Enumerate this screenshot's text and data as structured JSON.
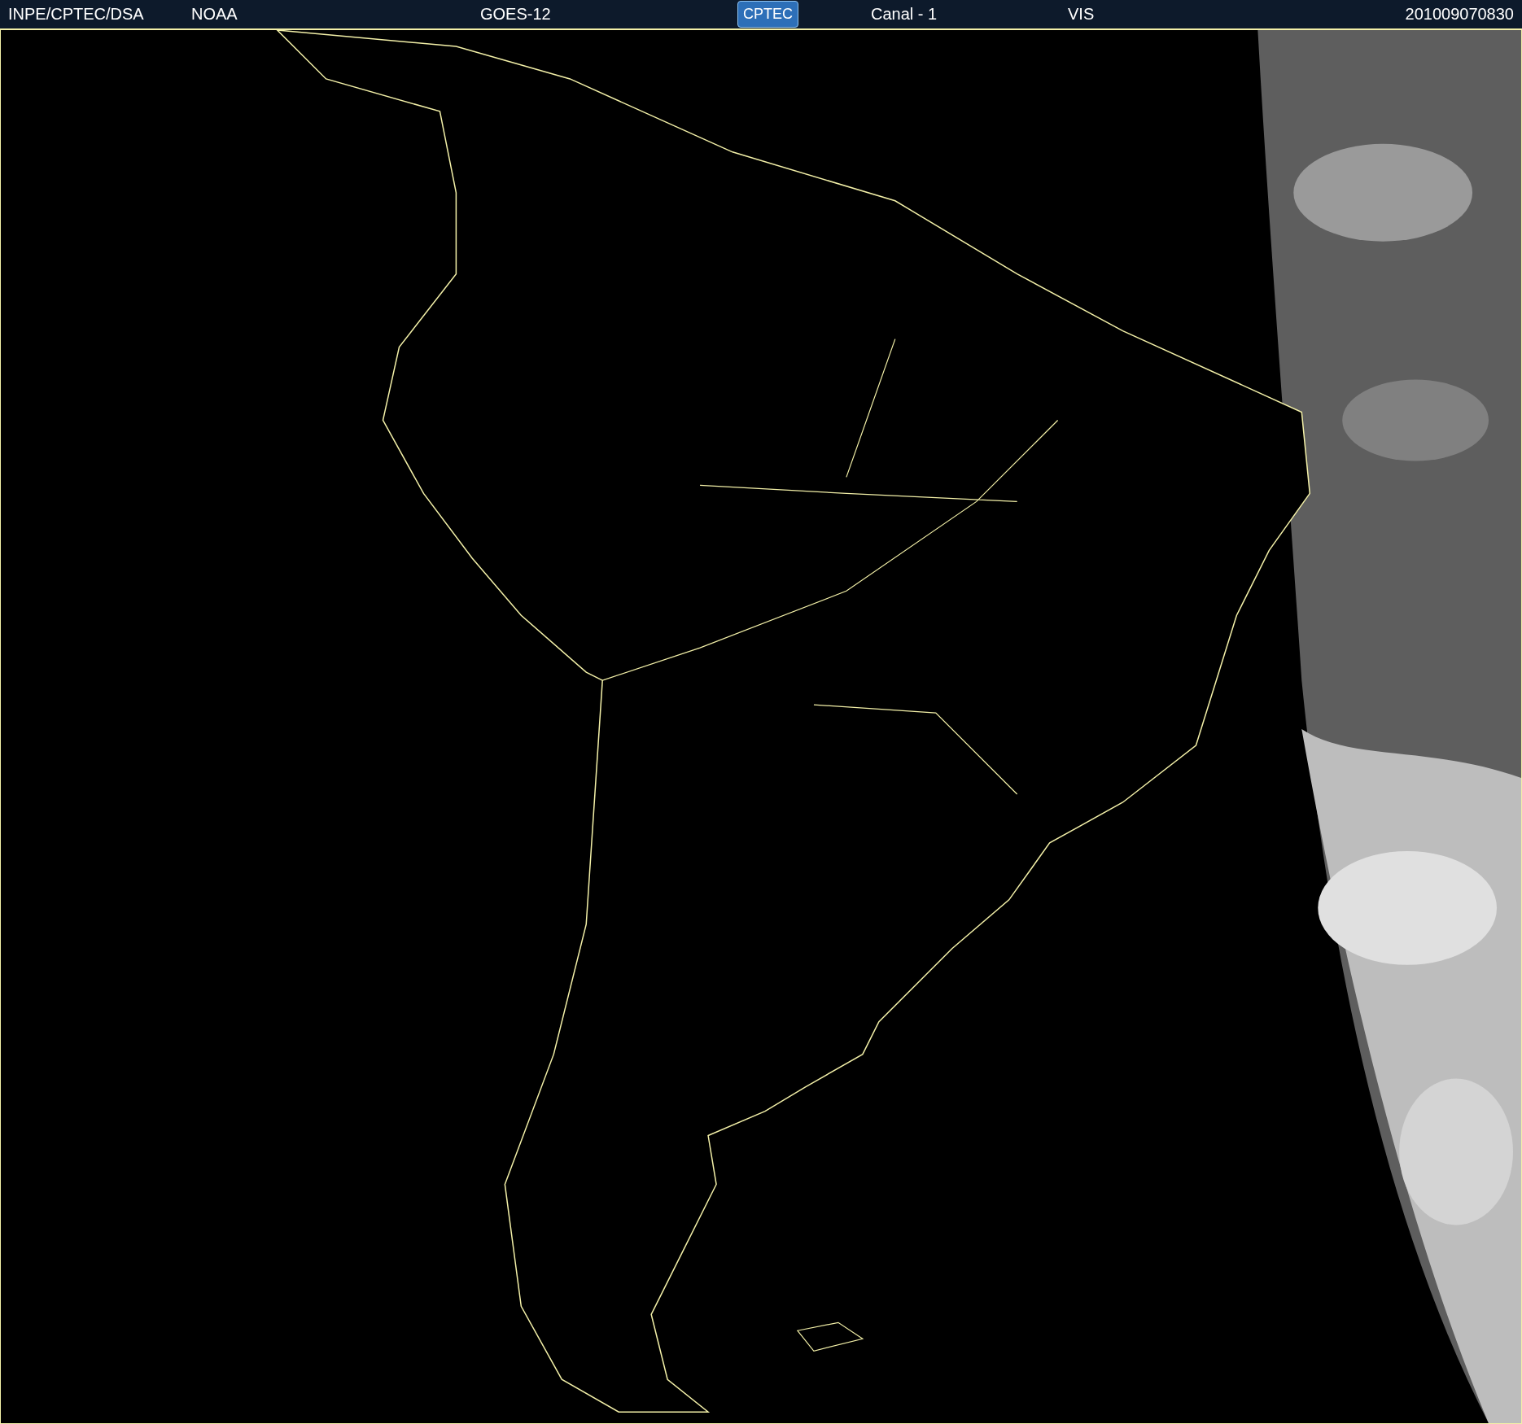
{
  "header": {
    "items": [
      {
        "kind": "text",
        "text": "INPE/CPTEC/DSA"
      },
      {
        "kind": "text",
        "text": "NOAA"
      },
      {
        "kind": "text",
        "text": "GOES-12"
      },
      {
        "kind": "logo",
        "text": "CPTEC"
      },
      {
        "kind": "text",
        "text": "Canal - 1"
      },
      {
        "kind": "text",
        "text": "VIS"
      },
      {
        "kind": "text",
        "text": "201009070830"
      }
    ]
  }
}
